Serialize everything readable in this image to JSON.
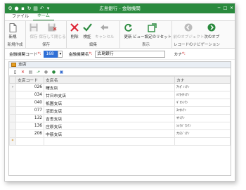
{
  "window": {
    "title": "広島銀行 - 金融機関"
  },
  "ribbon_tabs": [
    "ファイル",
    "ホーム"
  ],
  "ribbon": {
    "groups": [
      {
        "label": "新規作成",
        "buttons": [
          {
            "label": "新規",
            "icon": "new-doc-icon"
          }
        ]
      },
      {
        "label": "保存",
        "buttons": [
          {
            "label": "保存",
            "icon": "save-icon"
          },
          {
            "label": "保存して閉じる",
            "icon": "save-close-icon"
          }
        ]
      },
      {
        "label": "編集",
        "buttons": [
          {
            "label": "削除",
            "icon": "delete-icon"
          },
          {
            "label": "検証",
            "icon": "validate-icon"
          },
          {
            "label": "キャンセル",
            "icon": "cancel-icon"
          }
        ]
      },
      {
        "label": "表示",
        "buttons": [
          {
            "label": "更新",
            "icon": "refresh-icon"
          },
          {
            "label": "ビュー設定のリセット",
            "icon": "reset-view-icon"
          }
        ]
      },
      {
        "label": "レコードのナビゲーション",
        "buttons": [
          {
            "label": "前のオブジェクト",
            "icon": "prev-object-icon"
          },
          {
            "label": "次のオブ",
            "icon": "next-object-icon"
          }
        ]
      }
    ]
  },
  "form": {
    "code_label": "金融機関コード",
    "code_value": "168",
    "name_label": "金融機関名",
    "name_value": "広島銀行",
    "kana_label": "カナ"
  },
  "branch_panel": {
    "title": "支店",
    "columns": [
      "支店コード",
      "支店名",
      "カナ"
    ],
    "rows": [
      {
        "code": "026",
        "name": "曙支店",
        "kana": "ｱｹﾎﾞﾉｼﾃﾝ"
      },
      {
        "code": "034",
        "name": "廿日市支店",
        "kana": "ﾊﾂｶｲﾁｼﾃﾝ"
      },
      {
        "code": "040",
        "name": "祇園支店",
        "kana": "ｷﾞｵﾝｼﾃﾝ"
      },
      {
        "code": "077",
        "name": "沼田支店",
        "kana": "ﾇﾏﾀｼﾃﾝ"
      },
      {
        "code": "132",
        "name": "吉舎支店",
        "kana": "ｷｻｼﾃﾝ"
      },
      {
        "code": "136",
        "name": "庄原支店",
        "kana": "ｼｮｳﾊﾞﾗｼﾃﾝ"
      },
      {
        "code": "206",
        "name": "中筋支店",
        "kana": "ﾅｶｽｼﾞｼﾃﾝ"
      }
    ],
    "new_row_marker": "*"
  },
  "colors": {
    "titlebar": "#2a8a3e",
    "accent": "#2a8a3e",
    "required": "#d02020"
  }
}
